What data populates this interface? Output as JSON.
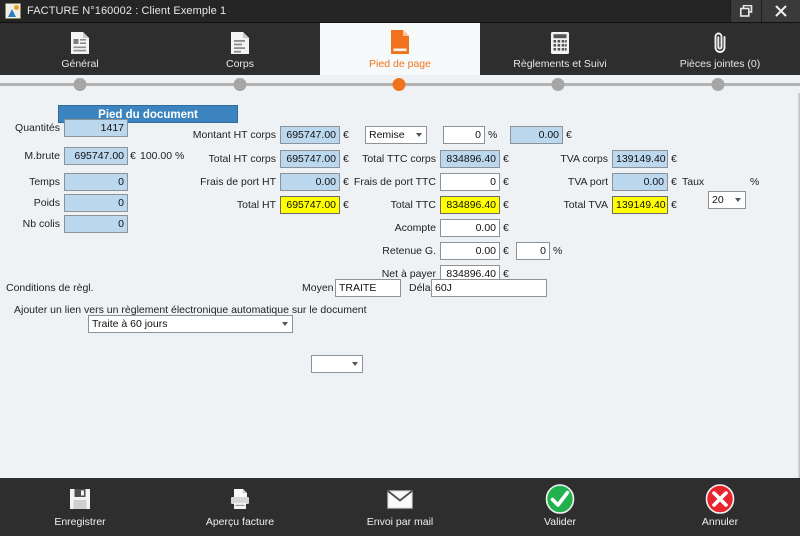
{
  "window": {
    "title": "FACTURE N°160002 : Client Exemple 1",
    "app_icon": "app-icon",
    "restore_label": "restore-icon",
    "close_label": "close-icon"
  },
  "tabs": [
    {
      "label": "Général",
      "icon": "document-general-icon",
      "active": false
    },
    {
      "label": "Corps",
      "icon": "document-lines-icon",
      "active": false
    },
    {
      "label": "Pied de page",
      "icon": "document-footer-icon",
      "active": true
    },
    {
      "label": "Règlements et Suivi",
      "icon": "calculator-icon",
      "active": false
    },
    {
      "label": "Pièces jointes (0)",
      "icon": "paperclip-icon",
      "active": false
    }
  ],
  "section": {
    "header": "Pied du document"
  },
  "left_column": [
    {
      "label": "Quantités",
      "value": "1417",
      "style": "blue"
    },
    {
      "label": "M.brute",
      "value": "695747.00",
      "style": "blue",
      "unit": "€",
      "extra": "100.00 %"
    },
    {
      "label": "Temps",
      "value": "0",
      "style": "blue"
    },
    {
      "label": "Poids",
      "value": "0",
      "style": "blue"
    },
    {
      "label": "Nb colis",
      "value": "0",
      "style": "blue"
    }
  ],
  "ht_column": [
    {
      "label": "Montant HT corps",
      "value": "695747.00",
      "style": "blue",
      "unit": "€"
    },
    {
      "label": "Total HT corps",
      "value": "695747.00",
      "style": "blue",
      "unit": "€"
    },
    {
      "label": "Frais de port HT",
      "value": "0.00",
      "style": "blue",
      "unit": "€"
    },
    {
      "label": "Total HT",
      "value": "695747.00",
      "style": "yellow",
      "unit": "€"
    }
  ],
  "remise": {
    "select_value": "Remise",
    "percent_value": "0",
    "percent_unit": "%",
    "amount_value": "0.00",
    "amount_unit": "€"
  },
  "ttc_column": [
    {
      "label": "Total TTC corps",
      "value": "834896.40",
      "style": "blue",
      "unit": "€"
    },
    {
      "label": "Frais de port TTC",
      "value": "0",
      "style": "white",
      "unit": "€"
    },
    {
      "label": "Total TTC",
      "value": "834896.40",
      "style": "yellow",
      "unit": "€"
    },
    {
      "label": "Acompte",
      "value": "0.00",
      "style": "white",
      "unit": "€"
    },
    {
      "label": "Retenue G.",
      "value": "0.00",
      "style": "white",
      "unit": "€",
      "extra_value": "0",
      "extra_unit": "%"
    },
    {
      "label": "Net à payer",
      "value": "834896.40",
      "style": "white",
      "unit": "€"
    }
  ],
  "tva_column": [
    {
      "label": "TVA corps",
      "value": "139149.40",
      "style": "blue",
      "unit": "€"
    },
    {
      "label": "TVA port",
      "value": "0.00",
      "style": "blue",
      "unit": "€"
    },
    {
      "label": "Total TVA",
      "value": "139149.40",
      "style": "yellow",
      "unit": "€"
    }
  ],
  "taux": {
    "label": "Taux",
    "value": "20",
    "unit": "%"
  },
  "payment": {
    "conditions_label": "Conditions de règl.",
    "conditions_value": "Traite à 60 jours",
    "moyen_label": "Moyen",
    "moyen_value": "TRAITE",
    "delai_label": "Délai",
    "delai_value": "60J",
    "link_label": "Ajouter un lien vers un règlement électronique automatique sur le document",
    "link_value": ""
  },
  "toolbar": [
    {
      "label": "Enregistrer",
      "icon": "save-icon"
    },
    {
      "label": "Aperçu facture",
      "icon": "print-preview-icon"
    },
    {
      "label": "Envoi par mail",
      "icon": "mail-icon"
    },
    {
      "label": "Valider",
      "icon": "validate-check-icon"
    },
    {
      "label": "Annuler",
      "icon": "cancel-cross-icon"
    }
  ],
  "colors": {
    "accent": "#f0741e",
    "header_blue": "#3b84bf",
    "field_blue": "#bcd8ef",
    "field_yellow": "#ffff00",
    "chrome_dark": "#2e2e2e",
    "validate_green": "#22b14c",
    "cancel_red": "#e8252d"
  }
}
